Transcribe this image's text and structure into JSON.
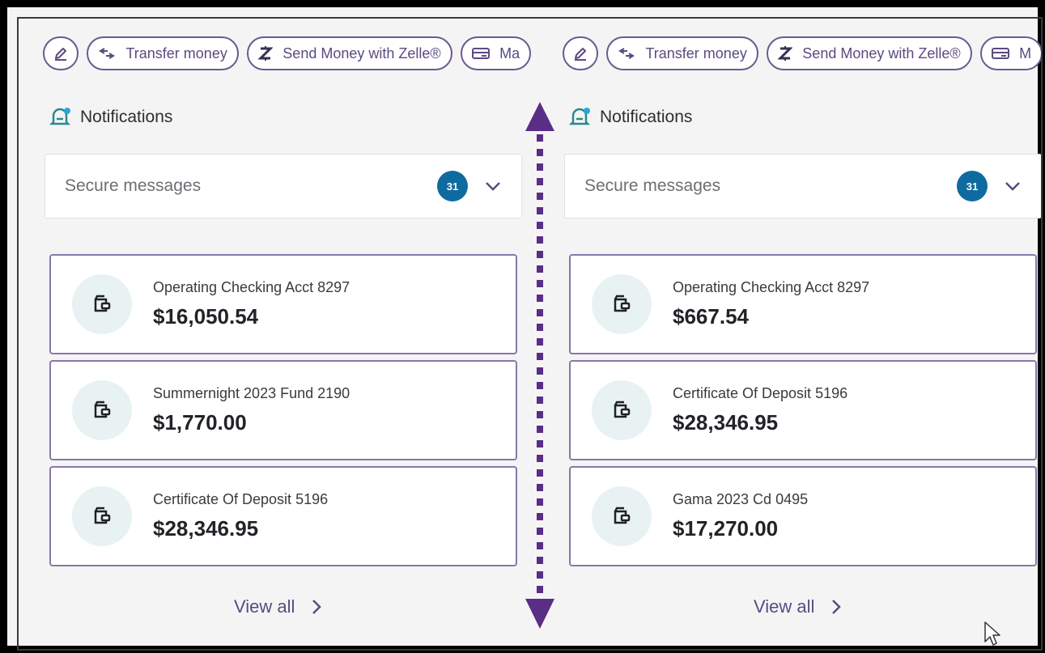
{
  "chips": {
    "edit_icon": "pencil-circle-icon",
    "transfer_label": "Transfer money",
    "zelle_label": "Send Money with Zelle®",
    "partial_left_label": "Ma",
    "partial_right_label": "M"
  },
  "notifications": {
    "title": "Notifications"
  },
  "secure_messages": {
    "label": "Secure messages",
    "count": "31"
  },
  "left_panel": {
    "accounts": [
      {
        "name": "Operating Checking Acct 8297",
        "balance": "$16,050.54"
      },
      {
        "name": "Summernight 2023 Fund 2190",
        "balance": "$1,770.00"
      },
      {
        "name": "Certificate Of Deposit 5196",
        "balance": "$28,346.95"
      }
    ]
  },
  "right_panel": {
    "accounts": [
      {
        "name": "Operating Checking Acct 8297",
        "balance": "$667.54"
      },
      {
        "name": "Certificate Of Deposit 5196",
        "balance": "$28,346.95"
      },
      {
        "name": "Gama 2023 Cd 0495",
        "balance": "$17,270.00"
      }
    ]
  },
  "view_all_label": "View all",
  "colors": {
    "accent": "#5b4a80",
    "badge": "#0f6aa0",
    "divider_arrow": "#5a2d86",
    "icon_teal": "#2a8a8a"
  }
}
